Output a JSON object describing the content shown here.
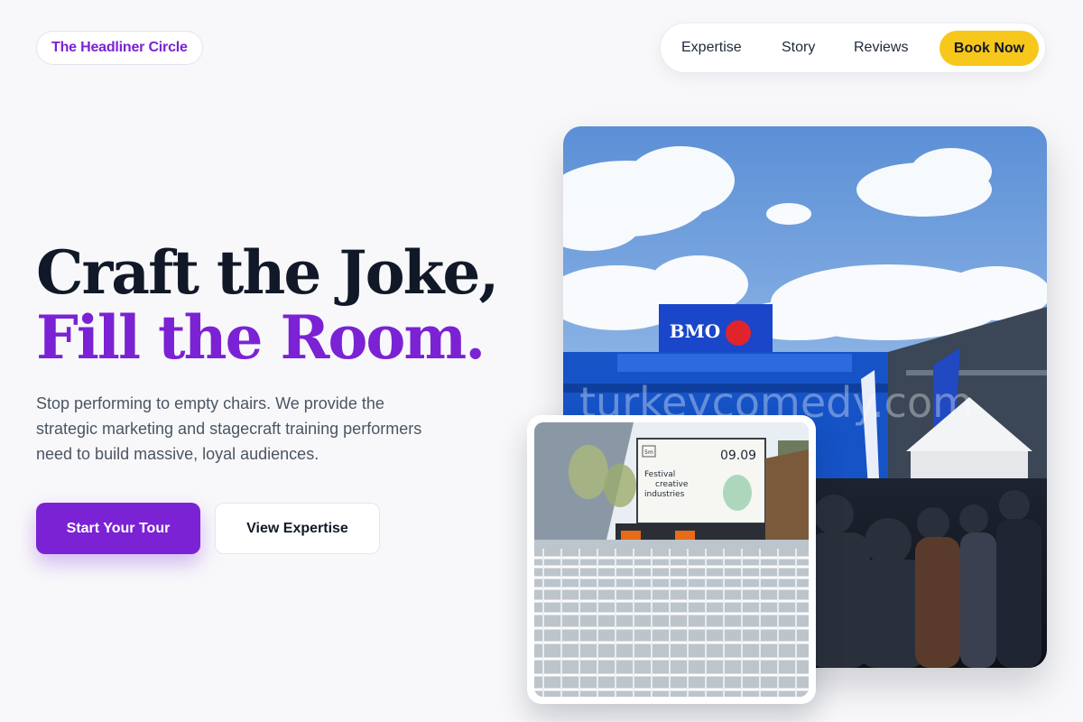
{
  "brand": {
    "name": "The Headliner Circle"
  },
  "nav": {
    "items": [
      {
        "label": "Expertise"
      },
      {
        "label": "Story"
      },
      {
        "label": "Reviews"
      }
    ],
    "cta_label": "Book Now"
  },
  "hero": {
    "headline_line1": "Craft the Joke,",
    "headline_line2": "Fill the Room.",
    "subtext": "Stop performing to empty chairs. We provide the strategic marketing and stagecraft training performers need to build massive, loyal audiences.",
    "primary_button": "Start Your Tour",
    "secondary_button": "View Expertise"
  },
  "photos": {
    "main": {
      "sign_text": "BMO",
      "watermark": "turkeycomedy.com"
    },
    "small": {
      "screen_date": "09.09",
      "screen_line1": "Festival",
      "screen_line2": "creative",
      "screen_line3": "industries",
      "screen_logo": "5m"
    }
  },
  "colors": {
    "accent_purple": "#7b22d4",
    "accent_yellow": "#f7c71c",
    "text_dark": "#111827",
    "text_muted": "#4b5563"
  }
}
